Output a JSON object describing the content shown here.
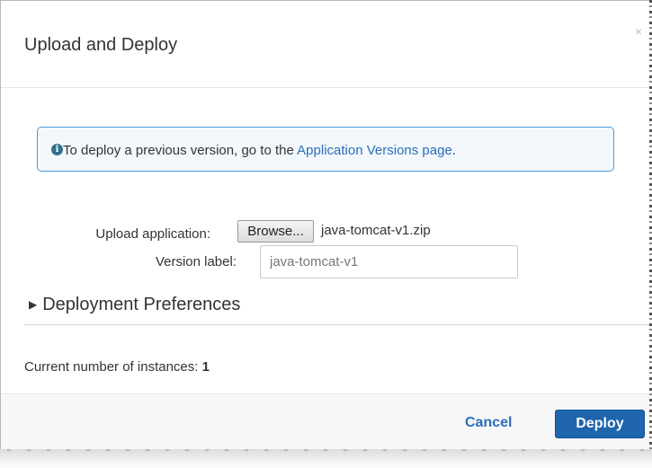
{
  "dialog": {
    "title": "Upload and Deploy",
    "close_glyph": "×"
  },
  "alert": {
    "icon": "info-circle-icon",
    "text_before": "To deploy a previous version, go to the ",
    "link_text": "Application Versions page",
    "text_after": "."
  },
  "form": {
    "upload_label": "Upload application:",
    "browse_label": "Browse...",
    "file_name": "java-tomcat-v1.zip",
    "version_label": "Version label:",
    "version_value": "java-tomcat-v1"
  },
  "preferences": {
    "toggle_glyph": "▶",
    "label": "Deployment Preferences"
  },
  "instances": {
    "label": "Current number of instances: ",
    "count": "1"
  },
  "footer": {
    "cancel_label": "Cancel",
    "deploy_label": "Deploy"
  },
  "colors": {
    "link": "#2a6ebb",
    "primary_button": "#1f65ad",
    "alert_border": "#4a9ad8",
    "alert_background": "#f3f8fc"
  }
}
